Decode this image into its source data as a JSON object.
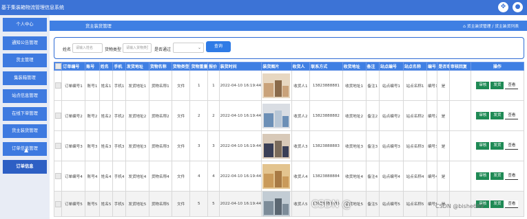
{
  "app": {
    "title": "基于集装箱物流管理信息系统"
  },
  "topbar": {
    "tools_icon": "dashboard-icon",
    "user_icon": "user-icon"
  },
  "sidebar": {
    "items": [
      {
        "label": "个人中心",
        "chevron": "⌄"
      },
      {
        "label": "通知公告管理",
        "chevron": "⌄"
      },
      {
        "label": "货主管理",
        "chevron": "⌄"
      },
      {
        "label": "集装箱管理",
        "chevron": "⌄"
      },
      {
        "label": "站点信息管理",
        "chevron": "⌄"
      },
      {
        "label": "在线下单管理",
        "chevron": "⌄"
      },
      {
        "label": "货主装货管理",
        "chevron": "⌄"
      },
      {
        "label": "订单信息管理",
        "chevron": "⌄"
      },
      {
        "label": "订单信息",
        "chevron": ""
      }
    ]
  },
  "breadcrumb": {
    "title": "货主装货管理",
    "path": "货主装货管理 / 货主装货列表"
  },
  "search": {
    "name_label": "姓名",
    "name_placeholder": "请输入姓名",
    "type_label": "货物类型",
    "type_placeholder": "请输入货物类型",
    "passed_label": "是否通过",
    "passed_value": "",
    "button_label": "查询"
  },
  "table": {
    "headers": [
      "订单编号",
      "账号",
      "姓名",
      "手机",
      "发货地址",
      "货物名称",
      "货物类型",
      "货物重量",
      "报价",
      "装货时间",
      "装货图片",
      "收货人",
      "联系方式",
      "收货地址",
      "备注",
      "站点编号",
      "站点名称",
      "编号",
      "是否审核",
      "审核回复",
      "操作"
    ],
    "rows": [
      [
        "订单编号1",
        "账号1",
        "姓名1",
        "手机1",
        "发货地址1",
        "货物名称1",
        "文件",
        "1",
        "1",
        "2022-04-10 16:19:44",
        "",
        "收货人1",
        "13823888881",
        "收货地址1",
        "备注1",
        "站点编号1",
        "站点名称1",
        "编号1",
        "是",
        ""
      ],
      [
        "订单编号2",
        "账号2",
        "姓名2",
        "手机2",
        "发货地址2",
        "货物名称2",
        "文件",
        "2",
        "2",
        "2022-04-10 16:19:44",
        "",
        "收货人2",
        "13823888882",
        "收货地址2",
        "备注2",
        "站点编号2",
        "站点名称2",
        "编号2",
        "是",
        ""
      ],
      [
        "订单编号3",
        "账号3",
        "姓名3",
        "手机3",
        "发货地址3",
        "货物名称3",
        "文件",
        "3",
        "3",
        "2022-04-10 16:19:44",
        "",
        "收货人3",
        "13823888883",
        "收货地址3",
        "备注3",
        "站点编号3",
        "站点名称3",
        "编号3",
        "是",
        ""
      ],
      [
        "订单编号4",
        "账号4",
        "姓名4",
        "手机4",
        "发货地址4",
        "货物名称4",
        "文件",
        "4",
        "4",
        "2022-04-10 16:19:44",
        "",
        "收货人4",
        "13823888884",
        "收货地址4",
        "备注4",
        "站点编号4",
        "站点名称4",
        "编号4",
        "是",
        ""
      ],
      [
        "订单编号5",
        "账号5",
        "姓名5",
        "手机5",
        "发货地址5",
        "货物名称5",
        "文件",
        "5",
        "5",
        "2022-04-10 16:19:44",
        "",
        "收货人5",
        "13823888885",
        "收货地址5",
        "备注5",
        "站点编号5",
        "站点名称5",
        "编号5",
        "是",
        ""
      ]
    ],
    "actions": {
      "audit": "审核",
      "ship": "发货",
      "view": "查看"
    }
  },
  "watermarks": {
    "center": "CSDN @",
    "corner": "CSDN @bishe689"
  },
  "colors": {
    "primary": "#3c73d6",
    "sidebar_item": "#3e7ae0",
    "action_green": "#1f8a55"
  }
}
